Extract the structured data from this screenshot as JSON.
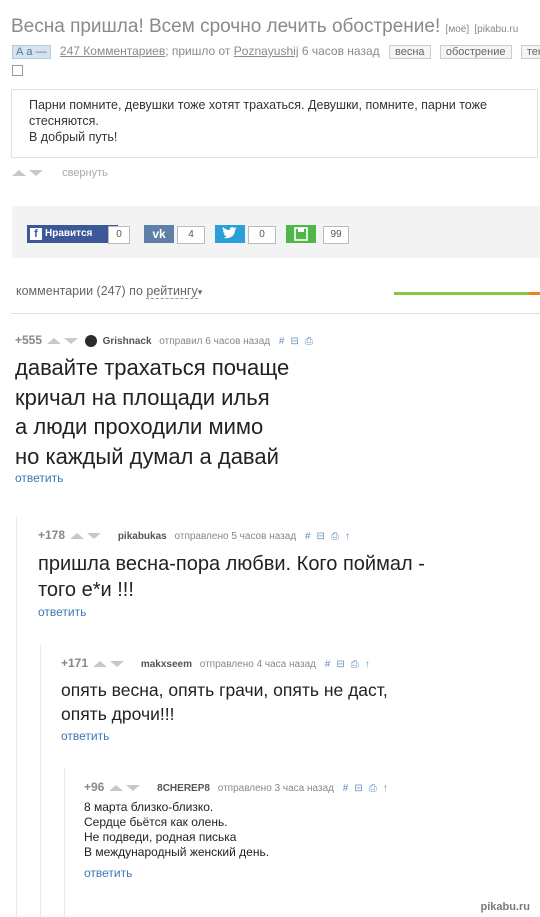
{
  "post": {
    "title": "Весна пришла! Всем срочно лечить обострение!",
    "badge_mine": "[моё]",
    "site": "[pikabu.ru",
    "aa": "А а —",
    "comments_link": "247 Комментариев",
    "posted_by_prefix": "; пришло от",
    "author": "Poznayushij",
    "time": "6 часов назад",
    "tags": [
      "весна",
      "обострение",
      "тек"
    ],
    "body": [
      "Парни помните, девушки тоже хотят трахаться. Девушки, помните, парни тоже стесняются.",
      "В добрый путь!"
    ],
    "collapse": "свернуть"
  },
  "share": {
    "like": "Нравится",
    "fb": "0",
    "vk": "4",
    "tw": "0",
    "ok": "99"
  },
  "sort": {
    "prefix": "комментарии (247) по",
    "mode": "рейтингу"
  },
  "comments": [
    {
      "score": "+555",
      "user": "Grishnack",
      "verb": "отправил",
      "time": "6 часов назад",
      "lines": [
        "давайте трахаться почаще",
        "кричал на площади илья",
        "а люди проходили мимо",
        "но каждый думал а давай"
      ],
      "reply": "ответить"
    },
    {
      "score": "+178",
      "user": "pikabukas",
      "verb": "отправлено",
      "time": "5 часов назад",
      "lines": [
        "пришла весна-пора любви. Кого поймал -",
        "того е*и !!!"
      ],
      "reply": "ответить"
    },
    {
      "score": "+171",
      "user": "makxseem",
      "verb": "отправлено",
      "time": "4 часа назад",
      "lines": [
        "опять весна, опять грачи, опять не даст,",
        "опять дрочи!!!"
      ],
      "reply": "ответить"
    },
    {
      "score": "+96",
      "user": "8CHEREP8",
      "verb": "отправлено",
      "time": "3 часа назад",
      "lines": [
        "8 марта близко-близко.",
        "Сердце бьётся как олень.",
        "Не подведи, родная писька",
        "В международный женский день."
      ],
      "reply": "ответить"
    }
  ],
  "watermark": "pikabu.ru"
}
